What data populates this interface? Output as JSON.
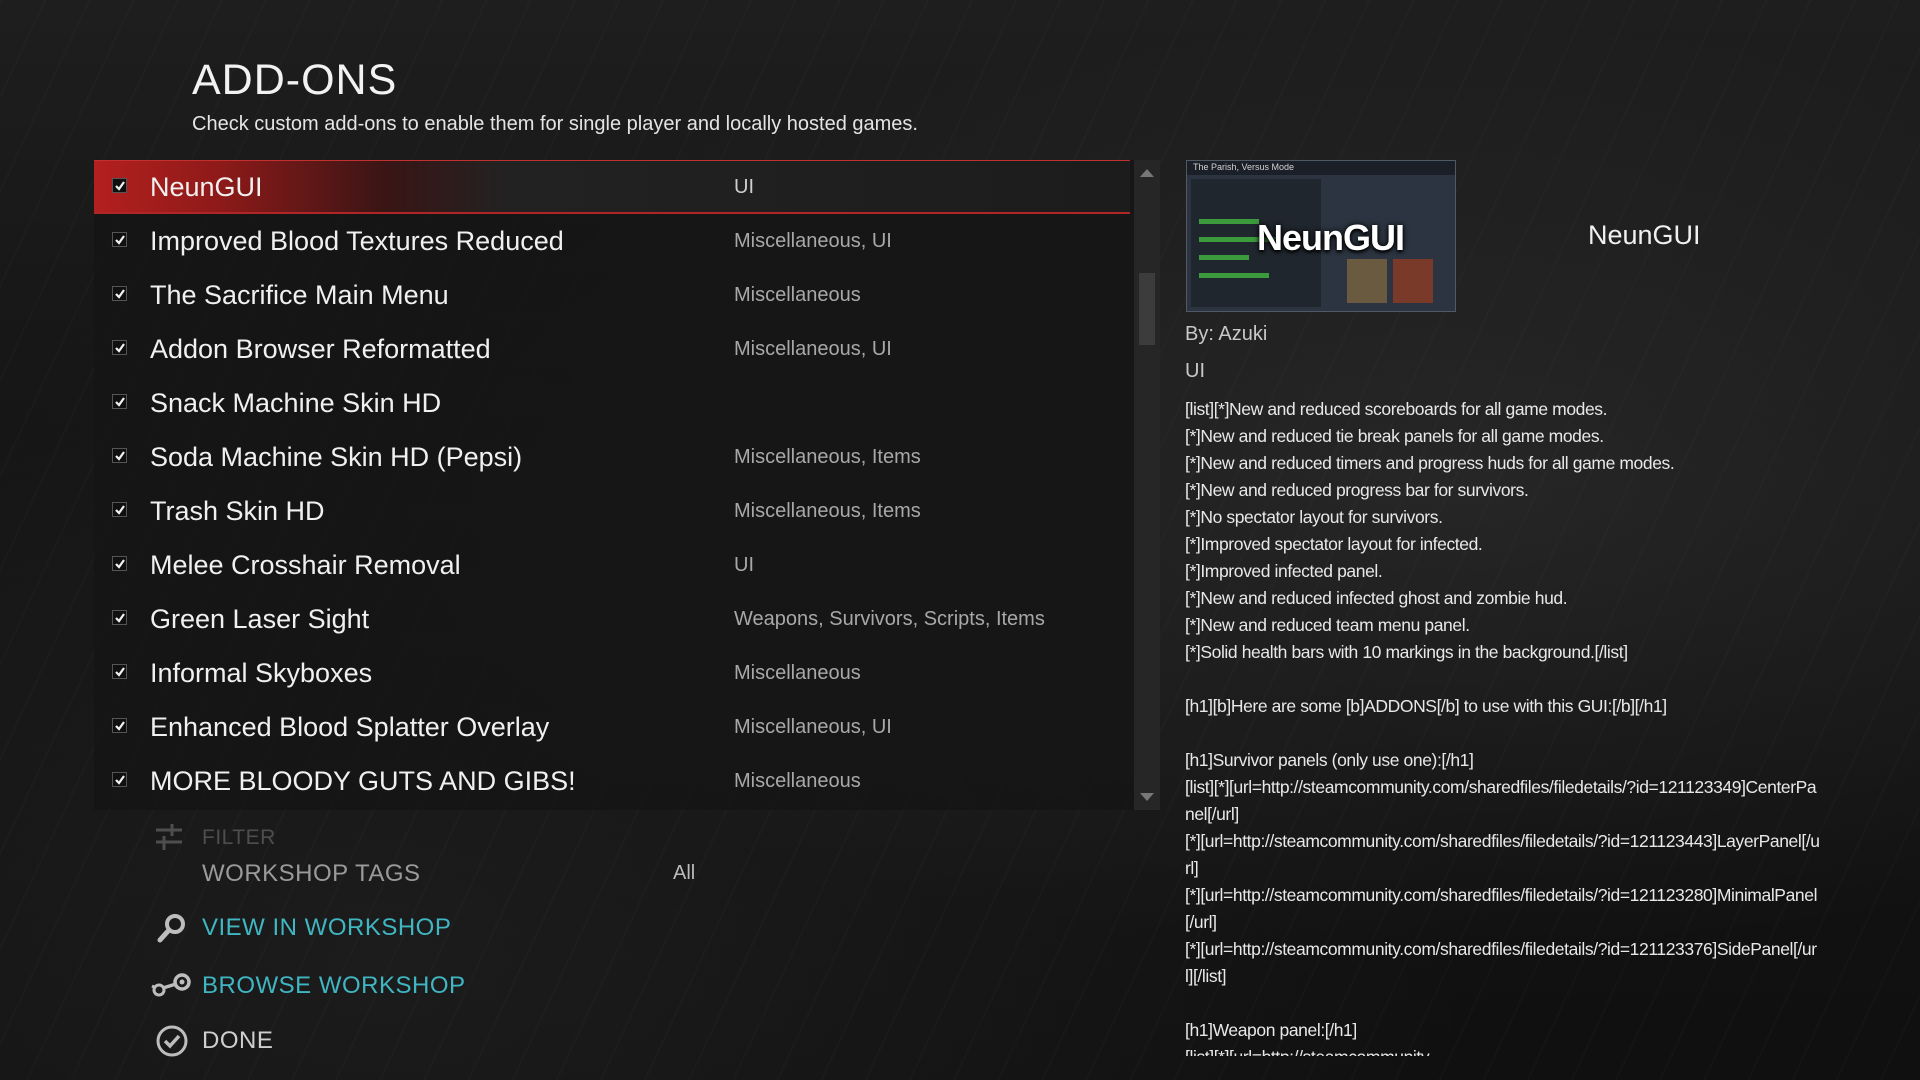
{
  "header": {
    "title": "ADD-ONS",
    "subtitle": "Check custom add-ons to enable them for single player and locally hosted games."
  },
  "addons": [
    {
      "name": "NeunGUI",
      "tags": "UI",
      "checked": true,
      "selected": true
    },
    {
      "name": "Improved Blood Textures Reduced",
      "tags": "Miscellaneous, UI",
      "checked": true
    },
    {
      "name": "The Sacrifice Main Menu",
      "tags": "Miscellaneous",
      "checked": true
    },
    {
      "name": "Addon Browser Reformatted",
      "tags": "Miscellaneous, UI",
      "checked": true
    },
    {
      "name": "Snack Machine Skin HD",
      "tags": "",
      "checked": true
    },
    {
      "name": "Soda Machine Skin HD (Pepsi)",
      "tags": "Miscellaneous, Items",
      "checked": true
    },
    {
      "name": "Trash Skin HD",
      "tags": "Miscellaneous, Items",
      "checked": true
    },
    {
      "name": "Melee Crosshair Removal",
      "tags": "UI",
      "checked": true
    },
    {
      "name": "Green Laser Sight",
      "tags": "Weapons, Survivors, Scripts, Items",
      "checked": true
    },
    {
      "name": "Informal Skyboxes",
      "tags": "Miscellaneous",
      "checked": true
    },
    {
      "name": "Enhanced Blood Splatter Overlay",
      "tags": "Miscellaneous, UI",
      "checked": true
    },
    {
      "name": "MORE BLOODY GUTS AND GIBS!",
      "tags": "Miscellaneous",
      "checked": true
    }
  ],
  "filter": {
    "label": "FILTER",
    "tags_label": "WORKSHOP TAGS",
    "tags_value": "All"
  },
  "actions": {
    "view_workshop": "VIEW IN WORKSHOP",
    "browse_workshop": "BROWSE WORKSHOP",
    "done": "DONE"
  },
  "detail": {
    "name": "NeunGUI",
    "author": "By: Azuki",
    "tags": "UI",
    "preview": {
      "logo": "NeunGUI",
      "header": "The Parish, Versus Mode"
    },
    "description": "[list][*]New and reduced scoreboards for all game modes.\n[*]New and reduced tie break panels for all game modes.\n[*]New and reduced timers and progress huds for all game modes.\n[*]New and reduced progress bar for survivors.\n[*]No spectator layout for survivors.\n[*]Improved spectator layout for infected.\n[*]Improved infected panel.\n[*]New and reduced infected ghost and zombie hud.\n[*]New and reduced team menu panel.\n[*]Solid health bars with 10 markings in the background.[/list]\n\n[h1][b]Here are some [b]ADDONS[/b] to use with this GUI:[/b][/h1]\n\n[h1]Survivor panels (only use one):[/h1]\n[list][*][url=http://steamcommunity.com/sharedfiles/filedetails/?id=121123349]CenterPanel[/url]\n[*][url=http://steamcommunity.com/sharedfiles/filedetails/?id=121123443]LayerPanel[/url]\n[*][url=http://steamcommunity.com/sharedfiles/filedetails/?id=121123280]MinimalPanel[/url]\n[*][url=http://steamcommunity.com/sharedfiles/filedetails/?id=121123376]SidePanel[/url][/list]\n\n[h1]Weapon panel:[/h1]\n[list][*][url=http://steamcommunity"
  },
  "colors": {
    "accent_red": "#b3201f",
    "link": "#3fb6c2"
  }
}
